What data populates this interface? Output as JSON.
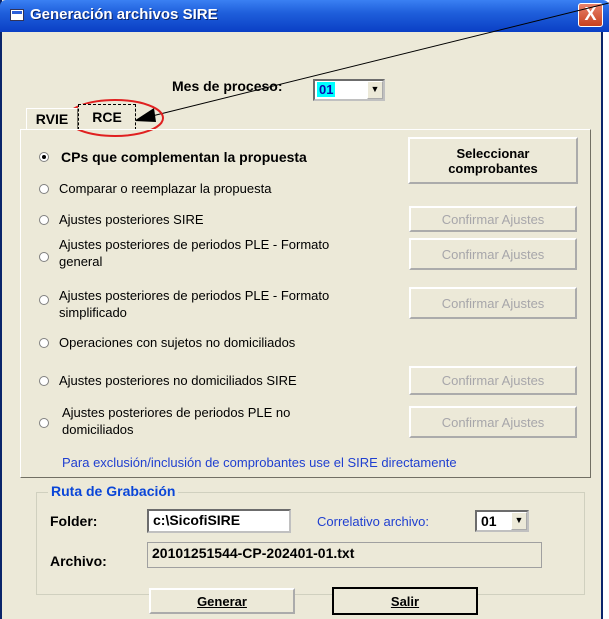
{
  "window": {
    "title": "Generación archivos SIRE",
    "close_label": "X"
  },
  "header": {
    "mes_label": "Mes de proceso:",
    "mes_value": "01"
  },
  "tabs": [
    {
      "label": "RVIE"
    },
    {
      "label": "RCE"
    }
  ],
  "options": [
    {
      "label": "CPs que complementan la propuesta",
      "checked": true
    },
    {
      "label": "Comparar o reemplazar la propuesta"
    },
    {
      "label": "Ajustes posteriores  SIRE"
    },
    {
      "label": "Ajustes posteriores de periodos PLE - Formato general"
    },
    {
      "label": "Ajustes posteriores de periodos PLE - Formato simplificado"
    },
    {
      "label": "Operaciones con sujetos no domiciliados"
    },
    {
      "label": "Ajustes posteriores no domiciliados SIRE"
    },
    {
      "label": "Ajustes posteriores de periodos PLE no domiciliados"
    }
  ],
  "buttons": {
    "seleccionar": "Seleccionar comprobantes",
    "confirmar": "Confirmar Ajustes",
    "generar": "Generar",
    "salir": "Salir"
  },
  "note": "Para exclusión/inclusión de comprobantes use el SIRE directamente",
  "ruta": {
    "legend": "Ruta de Grabación",
    "folder_label": "Folder:",
    "folder_value": "c:\\SicofiSIRE",
    "correlativo_label": "Correlativo archivo:",
    "correlativo_value": "01",
    "archivo_label": "Archivo:",
    "archivo_value": "20101251544-CP-202401-01.txt"
  },
  "colors": {
    "title_bar": "#1F5FDB",
    "annotation": "#E02020",
    "link_text": "#1F3FD0",
    "combo_highlight": "#00FFFF"
  }
}
